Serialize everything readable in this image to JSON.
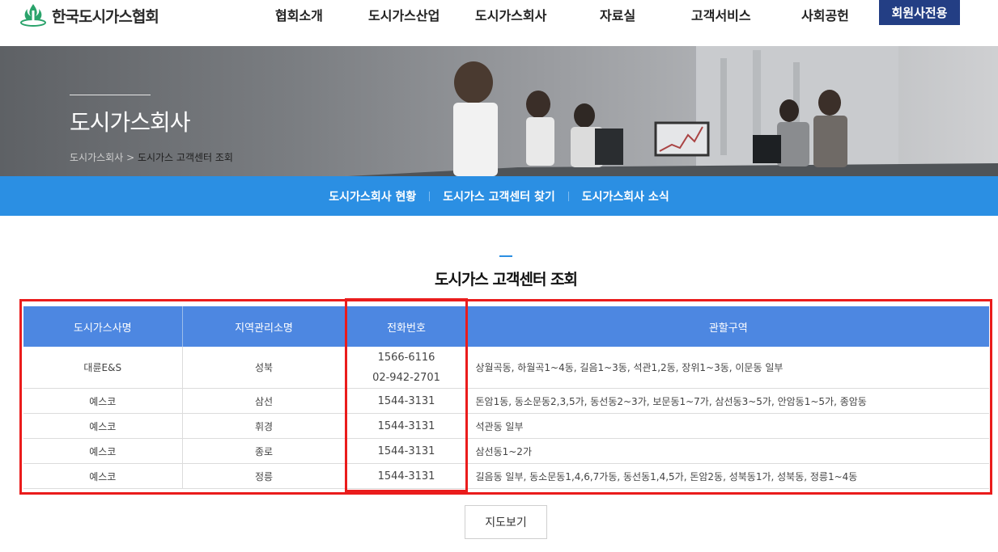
{
  "header": {
    "logo_text": "한국도시가스협회",
    "nav": [
      "협회소개",
      "도시가스산업",
      "도시가스회사",
      "자료실",
      "고객서비스",
      "사회공헌"
    ],
    "member_button": "회원사전용"
  },
  "banner": {
    "title": "도시가스회사",
    "breadcrumb_parent": "도시가스회사",
    "breadcrumb_sep": " > ",
    "breadcrumb_current": "도시가스 고객센터 조회"
  },
  "subnav": [
    "도시가스회사 현황",
    "도시가스 고객센터 찾기",
    "도시가스회사 소식"
  ],
  "section_title": "도시가스 고객센터 조회",
  "table": {
    "headers": [
      "도시가스사명",
      "지역관리소명",
      "전화번호",
      "관할구역"
    ],
    "rows": [
      {
        "company": "대륜E&S",
        "office": "성북",
        "phones": [
          "1566-6116",
          "02-942-2701"
        ],
        "area": "상월곡동, 하월곡1~4동, 길음1~3동, 석관1,2동, 장위1~3동, 이문동 일부"
      },
      {
        "company": "예스코",
        "office": "삼선",
        "phones": [
          "1544-3131"
        ],
        "area": "돈암1동, 동소문동2,3,5가, 동선동2~3가, 보문동1~7가, 삼선동3~5가, 안암동1~5가, 종암동"
      },
      {
        "company": "예스코",
        "office": "휘경",
        "phones": [
          "1544-3131"
        ],
        "area": "석관동 일부"
      },
      {
        "company": "예스코",
        "office": "종로",
        "phones": [
          "1544-3131"
        ],
        "area": "삼선동1~2가"
      },
      {
        "company": "예스코",
        "office": "정릉",
        "phones": [
          "1544-3131"
        ],
        "area": "길음동 일부, 동소문동1,4,6,7가동, 동선동1,4,5가, 돈암2동, 성북동1가, 성북동, 정릉1~4동"
      }
    ]
  },
  "map_button": "지도보기",
  "colors": {
    "brand_navy": "#233e84",
    "subnav_blue": "#2b8fe3",
    "table_header": "#4d87e1",
    "highlight_red": "#ea1c1c"
  },
  "icons": {
    "logo": "gas-flame-logo-icon"
  }
}
